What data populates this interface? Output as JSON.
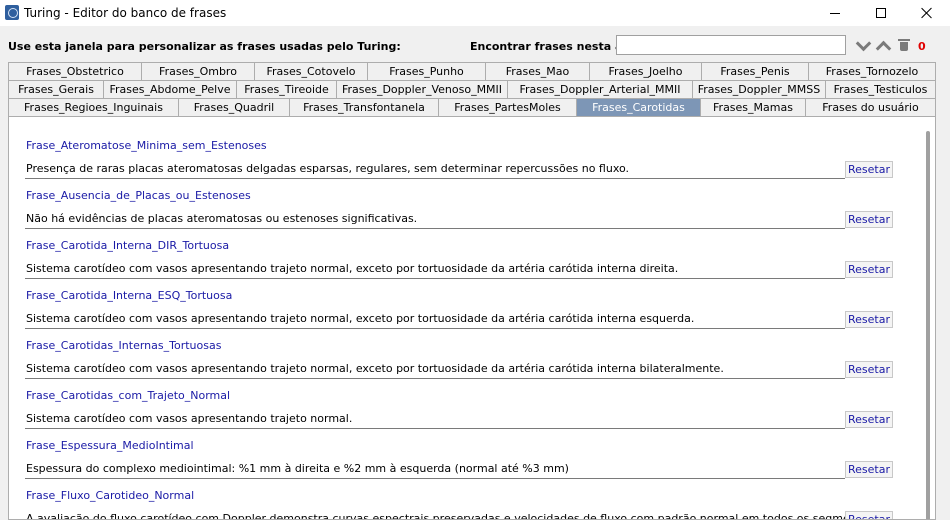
{
  "window": {
    "title": "Turing - Editor do banco de frases"
  },
  "toolbar": {
    "instruction": "Use esta janela para personalizar as frases usadas pelo Turing:",
    "find_label": "Encontrar frases nesta aba:",
    "find_value": "",
    "count": "0"
  },
  "tabs": {
    "row1": [
      "Frases_Obstetrico",
      "Frases_Ombro",
      "Frases_Cotovelo",
      "Frases_Punho",
      "Frases_Mao",
      "Frases_Joelho",
      "Frases_Penis",
      "Frases_Tornozelo"
    ],
    "row2": [
      "Frases_Gerais",
      "Frases_Abdome_Pelve",
      "Frases_Tireoide",
      "Frases_Doppler_Venoso_MMII",
      "Frases_Doppler_Arterial_MMII",
      "Frases_Doppler_MMSS",
      "Frases_Testiculos"
    ],
    "row3": [
      "Frases_Regioes_Inguinais",
      "Frases_Quadril",
      "Frases_Transfontanela",
      "Frases_PartesMoles",
      "Frases_Carotidas",
      "Frases_Mamas",
      "Frases do usuário"
    ],
    "active": "Frases_Carotidas"
  },
  "phrases": {
    "reset_label": "Resetar",
    "items": [
      {
        "name": "Frase_Ateromatose_Minima_sem_Estenoses",
        "text": "Presença de raras placas ateromatosas delgadas esparsas, regulares, sem determinar repercussões no fluxo."
      },
      {
        "name": "Frase_Ausencia_de_Placas_ou_Estenoses",
        "text": "Não há evidências de placas ateromatosas ou estenoses significativas."
      },
      {
        "name": "Frase_Carotida_Interna_DIR_Tortuosa",
        "text": "Sistema carotídeo com vasos apresentando trajeto normal, exceto por tortuosidade da artéria carótida interna direita."
      },
      {
        "name": "Frase_Carotida_Interna_ESQ_Tortuosa",
        "text": "Sistema carotídeo com vasos apresentando trajeto normal, exceto por tortuosidade da artéria carótida interna esquerda."
      },
      {
        "name": "Frase_Carotidas_Internas_Tortuosas",
        "text": "Sistema carotídeo com vasos apresentando trajeto normal, exceto por tortuosidade da artéria carótida interna bilateralmente."
      },
      {
        "name": "Frase_Carotidas_com_Trajeto_Normal",
        "text": "Sistema carotídeo com vasos apresentando trajeto normal."
      },
      {
        "name": "Frase_Espessura_MedioIntimal",
        "text": "Espessura do complexo mediointimal: %1 mm à direita e %2 mm à esquerda (normal até %3 mm)"
      },
      {
        "name": "Frase_Fluxo_Carotideo_Normal",
        "text": "A avaliação do fluxo carotídeo com Doppler demonstra curvas espectrais preservadas e velocidades de fluxo com padrão normal em todos os segmentos avaliados."
      }
    ]
  }
}
